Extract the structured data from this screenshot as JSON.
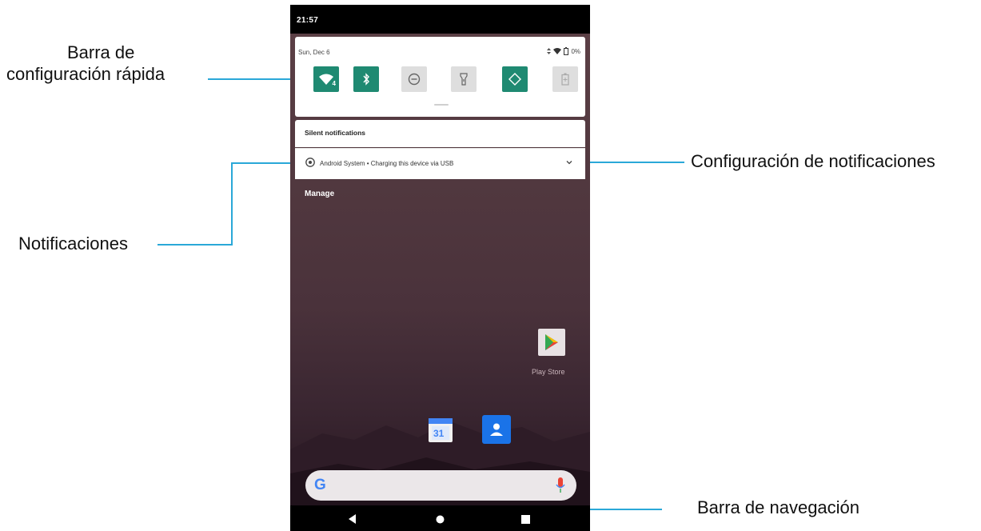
{
  "callouts": {
    "quick_settings_line1": "Barra de",
    "quick_settings_line2": "configuración rápida",
    "notifications": "Notificaciones",
    "notification_settings": "Configuración de notificaciones",
    "navigation_bar": "Barra de navegación"
  },
  "status_bar": {
    "time": "21:57"
  },
  "quick_settings": {
    "date": "Sun, Dec 6",
    "battery_text": "0%",
    "tiles": [
      {
        "icon": "wifi-icon",
        "state": "on",
        "badge": "4"
      },
      {
        "icon": "bluetooth-icon",
        "state": "on"
      },
      {
        "icon": "do-not-disturb-icon",
        "state": "off"
      },
      {
        "icon": "flashlight-icon",
        "state": "off"
      },
      {
        "icon": "auto-rotate-icon",
        "state": "on"
      },
      {
        "icon": "battery-saver-icon",
        "state": "off"
      }
    ]
  },
  "notifications": {
    "section_title": "Silent notifications",
    "items": [
      {
        "app": "Android System",
        "separator": "•",
        "text": "Charging this device via USB"
      }
    ],
    "manage_label": "Manage"
  },
  "home": {
    "play_store_label": "Play Store",
    "calendar_day": "31"
  },
  "colors": {
    "tile_on": "#1f8a72",
    "tile_off": "#dedede",
    "callout_line": "#2aa8d8",
    "google_blue": "#4285f4"
  }
}
